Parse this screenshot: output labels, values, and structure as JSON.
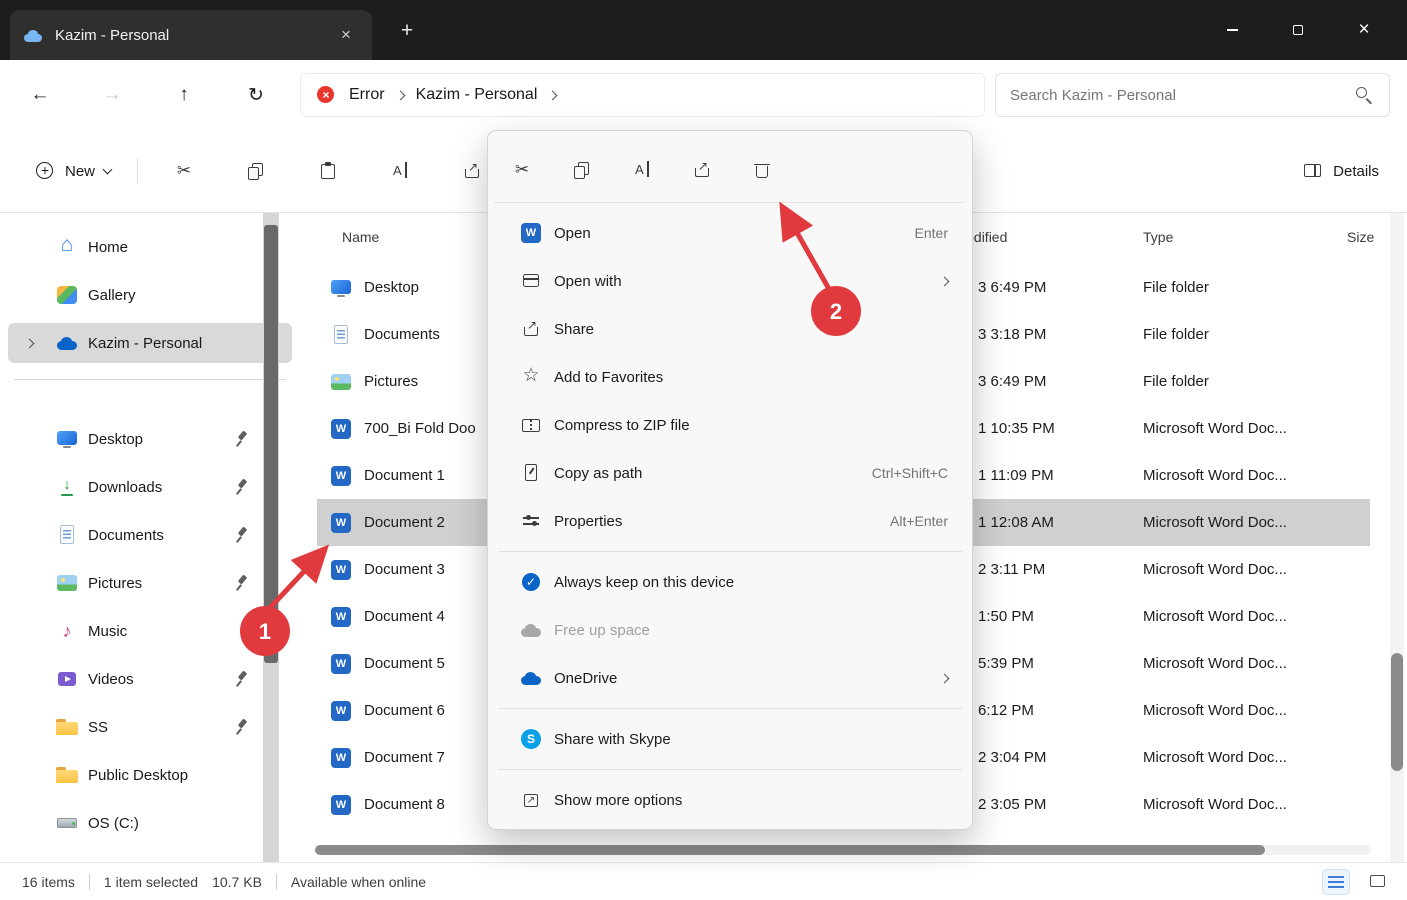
{
  "titlebar": {
    "tab_title": "Kazim - Personal"
  },
  "navbar": {
    "breadcrumb": {
      "error_label": "Error",
      "folder_label": "Kazim - Personal"
    },
    "search_placeholder": "Search Kazim - Personal"
  },
  "toolbar": {
    "new_label": "New",
    "details_label": "Details"
  },
  "sidebar": {
    "items": [
      {
        "label": "Home",
        "icon": "home",
        "pinned": false
      },
      {
        "label": "Gallery",
        "icon": "gallery",
        "pinned": false
      },
      {
        "label": "Kazim - Personal",
        "icon": "onedrive",
        "selected": true,
        "expander": true
      },
      {
        "divider": true
      },
      {
        "label": "Desktop",
        "icon": "desktop",
        "pinned": true
      },
      {
        "label": "Downloads",
        "icon": "downloads",
        "pinned": true
      },
      {
        "label": "Documents",
        "icon": "documents",
        "pinned": true
      },
      {
        "label": "Pictures",
        "icon": "pictures",
        "pinned": true
      },
      {
        "label": "Music",
        "icon": "music",
        "pinned": false
      },
      {
        "label": "Videos",
        "icon": "videos",
        "pinned": true
      },
      {
        "label": "SS",
        "icon": "folder",
        "pinned": true
      },
      {
        "label": "Public Desktop",
        "icon": "folder",
        "pinned": false
      },
      {
        "label": "OS (C:)",
        "icon": "drive",
        "pinned": false
      }
    ]
  },
  "file_list": {
    "columns": {
      "name": "Name",
      "modified": "Date modified",
      "type": "Type",
      "size": "Size"
    },
    "rows": [
      {
        "name": "Desktop",
        "icon": "desktop",
        "modified": "3 6:49 PM",
        "type": "File folder",
        "size": ""
      },
      {
        "name": "Documents",
        "icon": "documents",
        "modified": "3 3:18 PM",
        "type": "File folder",
        "size": ""
      },
      {
        "name": "Pictures",
        "icon": "pictures",
        "modified": "3 6:49 PM",
        "type": "File folder",
        "size": ""
      },
      {
        "name": "700_Bi Fold Doo",
        "icon": "word",
        "modified": "1 10:35 PM",
        "type": "Microsoft Word Doc...",
        "size": ""
      },
      {
        "name": "Document 1",
        "icon": "word",
        "modified": "1 11:09 PM",
        "type": "Microsoft Word Doc...",
        "size": ""
      },
      {
        "name": "Document 2",
        "icon": "word",
        "modified": "1 12:08 AM",
        "type": "Microsoft Word Doc...",
        "size": "",
        "selected": true
      },
      {
        "name": "Document 3",
        "icon": "word",
        "modified": "2 3:11 PM",
        "type": "Microsoft Word Doc...",
        "size": ""
      },
      {
        "name": "Document 4",
        "icon": "word",
        "modified": "1:50 PM",
        "type": "Microsoft Word Doc...",
        "size": ""
      },
      {
        "name": "Document 5",
        "icon": "word",
        "modified": "5:39 PM",
        "type": "Microsoft Word Doc...",
        "size": ""
      },
      {
        "name": "Document 6",
        "icon": "word",
        "modified": "6:12 PM",
        "type": "Microsoft Word Doc...",
        "size": ""
      },
      {
        "name": "Document 7",
        "icon": "word",
        "modified": "2 3:04 PM",
        "type": "Microsoft Word Doc...",
        "size": ""
      },
      {
        "name": "Document 8",
        "icon": "word",
        "modified": "2 3:05 PM",
        "type": "Microsoft Word Doc...",
        "size": ""
      }
    ]
  },
  "context_menu": {
    "quick_actions": [
      {
        "name": "cut",
        "icon": "cut"
      },
      {
        "name": "copy",
        "icon": "copy"
      },
      {
        "name": "rename",
        "icon": "rename"
      },
      {
        "name": "share",
        "icon": "share"
      },
      {
        "name": "delete",
        "icon": "trash"
      }
    ],
    "items": [
      {
        "label": "Open",
        "icon": "word",
        "shortcut": "Enter"
      },
      {
        "label": "Open with",
        "icon": "openwith",
        "submenu": true
      },
      {
        "label": "Share",
        "icon": "share"
      },
      {
        "label": "Add to Favorites",
        "icon": "star"
      },
      {
        "label": "Compress to ZIP file",
        "icon": "zip"
      },
      {
        "label": "Copy as path",
        "icon": "copypath",
        "shortcut": "Ctrl+Shift+C"
      },
      {
        "label": "Properties",
        "icon": "properties",
        "shortcut": "Alt+Enter"
      },
      {
        "divider": true
      },
      {
        "label": "Always keep on this device",
        "icon": "cloud-check"
      },
      {
        "label": "Free up space",
        "icon": "cloud-gray",
        "disabled": true
      },
      {
        "label": "OneDrive",
        "icon": "cloud-blue",
        "submenu": true
      },
      {
        "divider": true
      },
      {
        "label": "Share with Skype",
        "icon": "skype"
      },
      {
        "divider": true
      },
      {
        "label": "Show more options",
        "icon": "more"
      }
    ]
  },
  "status_bar": {
    "items_count": "16 items",
    "selection": "1 item selected",
    "selection_size": "10.7 KB",
    "availability": "Available when online"
  },
  "annotations": {
    "step1": "1",
    "step2": "2"
  },
  "colors": {
    "accent_red": "#e0393e",
    "onedrive_blue": "#0a64c8",
    "word_blue": "#2368c4",
    "titlebar_dark": "#1d1d1d",
    "selection_gray": "#d0d0d0"
  }
}
